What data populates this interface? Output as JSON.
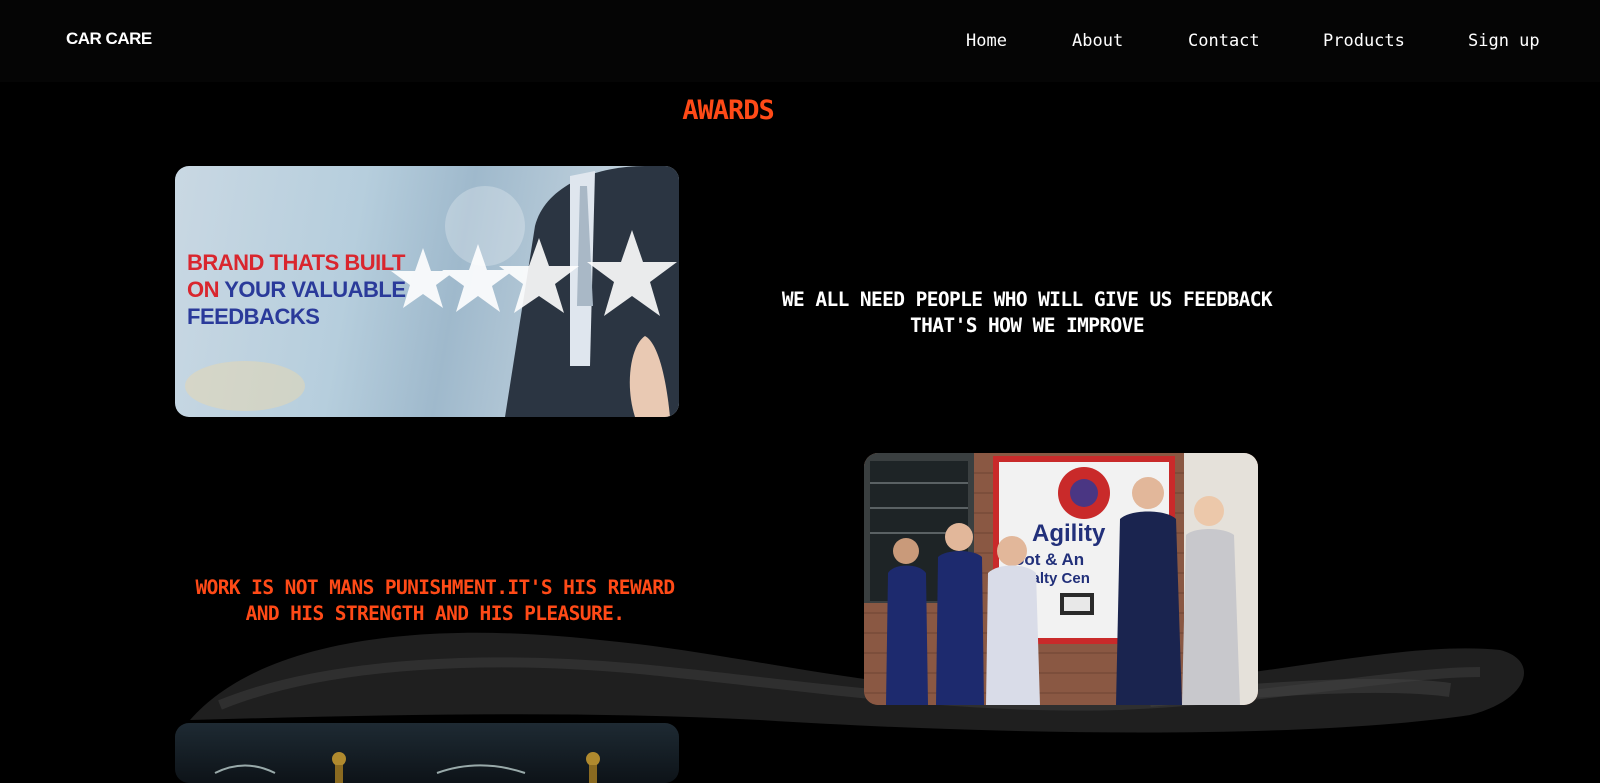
{
  "nav": {
    "logo": "CAR CARE",
    "links": [
      "Home",
      "About",
      "Contact",
      "Products",
      "Sign up"
    ]
  },
  "awards": {
    "title": "AWARDS",
    "quote_feedback": "WE ALL NEED PEOPLE WHO WILL GIVE US FEEDBACK\nTHAT'S HOW WE IMPROVE",
    "quote_work": "WORK IS NOT MANS PUNISHMENT.IT'S HIS REWARD\nAND HIS STRENGTH AND HIS PLEASURE."
  },
  "feedback_banner": {
    "line1": "BRAND THATS BUILT",
    "line2_a": "ON",
    "line2_b": "YOUR VALUABLE",
    "line3": "FEEDBACKS"
  },
  "photo_sign": {
    "text1": "Agility",
    "text2": "oot & An",
    "text3": "cialty Cen"
  },
  "colors": {
    "accent": "#ff4a17",
    "background": "#000000",
    "banner_red": "#d9262e",
    "banner_blue": "#2a3a9a"
  }
}
